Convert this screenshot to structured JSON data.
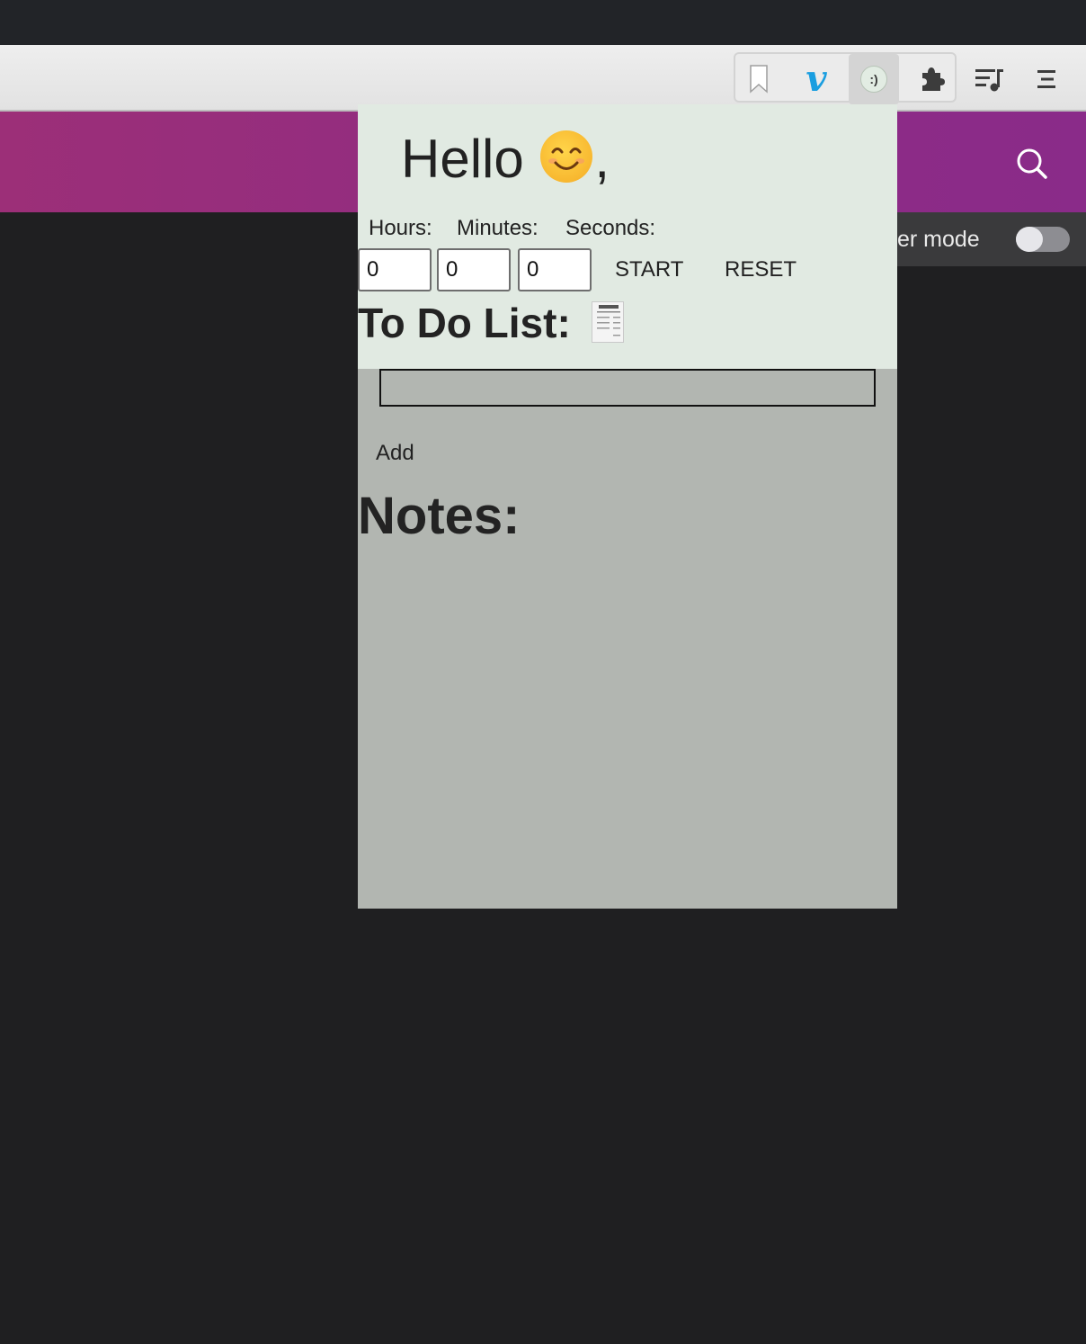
{
  "toolbar": {
    "icons": [
      "bookmark-icon",
      "vimeo-icon",
      "smiley-extension-icon",
      "puzzle-icon",
      "media-queue-icon",
      "menu-icon"
    ],
    "smiley_glyph": ":)",
    "vimeo_glyph": "v"
  },
  "site": {
    "header_color": "#9c2f78",
    "mode_label": "er mode"
  },
  "popup": {
    "greeting": "Hello",
    "greeting_suffix": ",",
    "timer": {
      "hours_label": "Hours:",
      "minutes_label": "Minutes:",
      "seconds_label": "Seconds:",
      "hours_value": "0",
      "minutes_value": "0",
      "seconds_value": "0",
      "start_label": "START",
      "reset_label": "RESET"
    },
    "todo": {
      "title": "To Do List:",
      "input_value": "",
      "add_label": "Add"
    },
    "notes": {
      "title": "Notes:"
    },
    "colors": {
      "top_bg": "#e1eae2",
      "bottom_bg": "#b2b6b1"
    }
  }
}
